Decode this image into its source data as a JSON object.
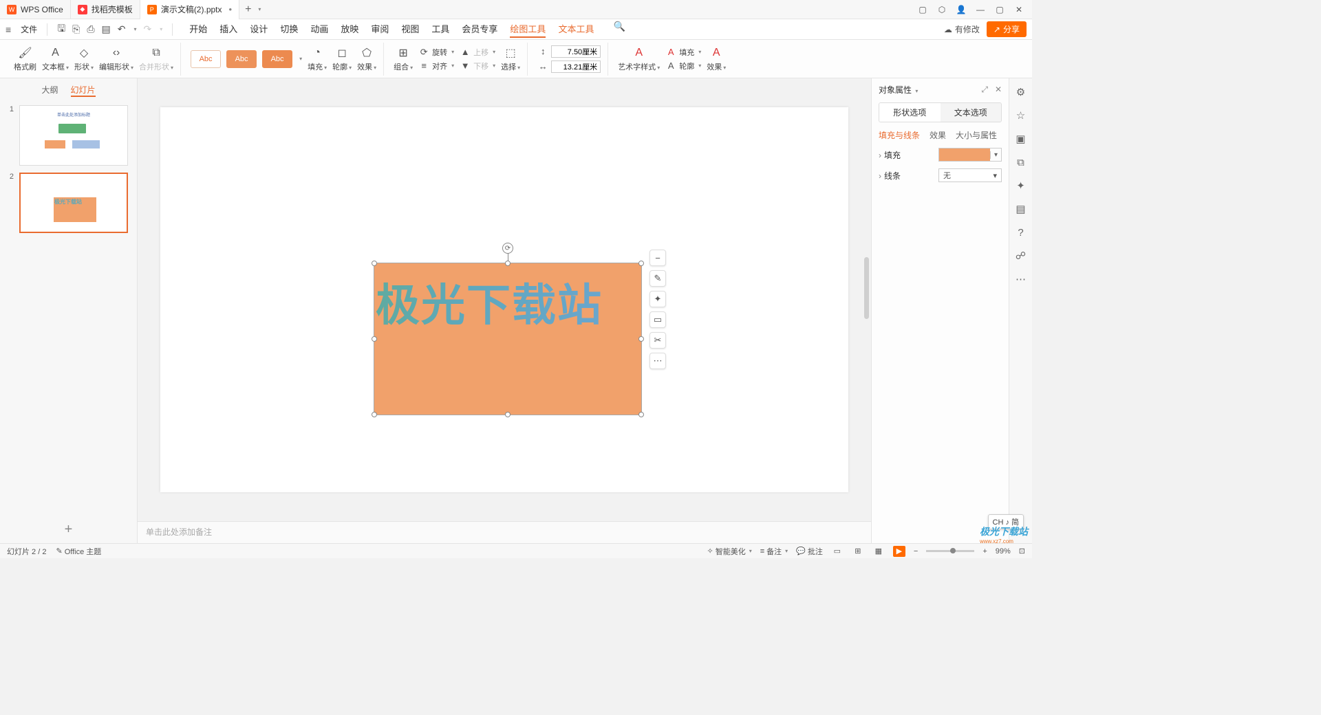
{
  "titlebar": {
    "tabs": [
      {
        "icon_bg": "#ff5a1f",
        "icon_text": "W",
        "label": "WPS Office"
      },
      {
        "icon_bg": "#ff3b3b",
        "icon_text": "◆",
        "label": "找稻壳模板"
      },
      {
        "icon_bg": "#ff6a00",
        "icon_text": "P",
        "label": "演示文稿(2).pptx"
      }
    ],
    "add": "+"
  },
  "menubar": {
    "file": "文件",
    "tabs": [
      "开始",
      "插入",
      "设计",
      "切换",
      "动画",
      "放映",
      "审阅",
      "视图",
      "工具",
      "会员专享",
      "绘图工具",
      "文本工具"
    ],
    "active_tabs": [
      "绘图工具",
      "文本工具"
    ],
    "cloud_label": "有修改",
    "share_label": "分享"
  },
  "ribbon": {
    "format_painter": "格式刷",
    "text_box": "文本框",
    "shape": "形状",
    "edit_shape": "编辑形状",
    "merge_shape": "合并形状",
    "style_label": "Abc",
    "fill": "填充",
    "outline": "轮廓",
    "effect": "效果",
    "group": "组合",
    "rotate": "旋转",
    "align": "对齐",
    "move_up": "上移",
    "move_down": "下移",
    "select": "选择",
    "height_label": "7.50厘米",
    "width_label": "13.21厘米",
    "art_style": "艺术字样式",
    "t_fill": "填充",
    "t_outline": "轮廓",
    "t_effect": "效果"
  },
  "slidepanel": {
    "tab_outline": "大纲",
    "tab_slides": "幻灯片",
    "slide1_num": "1",
    "slide2_num": "2",
    "t1_title": "单击此处添加标题",
    "t2_text": "极光下载站"
  },
  "canvas": {
    "shape_text": "极光下载站",
    "notes_placeholder": "单击此处添加备注"
  },
  "rightpanel": {
    "title": "对象属性",
    "tab_shape": "形状选项",
    "tab_text": "文本选项",
    "sub_fill": "填充与线条",
    "sub_effect": "效果",
    "sub_size": "大小与属性",
    "row_fill": "填充",
    "row_line": "线条",
    "line_value": "无"
  },
  "statusbar": {
    "slide_count": "幻灯片 2 / 2",
    "theme": "Office 主题",
    "beautify": "智能美化",
    "notes": "备注",
    "comments": "批注",
    "zoom": "99%"
  },
  "ime": "CH ♪ 简",
  "watermark": {
    "line1": "极光下载站",
    "line2": "www.xz7.com"
  }
}
